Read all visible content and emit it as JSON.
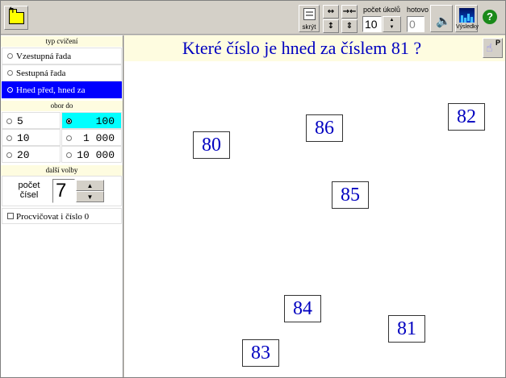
{
  "toolbar": {
    "hide_label": "skrýt",
    "count_label": "počet úkolů",
    "count_value": "10",
    "done_label": "hotovo",
    "done_value": "0",
    "results_label": "Výsledky",
    "help_symbol": "?",
    "hand_letter": "P"
  },
  "sidebar": {
    "exercise_type_header": "typ cvičení",
    "exercise_types": [
      {
        "label": "Vzestupná řada",
        "selected": false
      },
      {
        "label": "Sestupná řada",
        "selected": false
      },
      {
        "label": "Hned před, hned za",
        "selected": true
      }
    ],
    "range_header": "obor do",
    "ranges_left": [
      "5",
      "10",
      "20"
    ],
    "ranges_right": [
      "100",
      "1 000",
      "10 000"
    ],
    "range_selected": "100",
    "options_header": "další volby",
    "count_label_line1": "počet",
    "count_label_line2": "čísel",
    "count_value": "7",
    "zero_label": "Procvičovat i číslo 0"
  },
  "main": {
    "question": "Které číslo je hned za číslem 81 ?",
    "cards": [
      "80",
      "86",
      "82",
      "85",
      "84",
      "81",
      "83"
    ]
  },
  "colors": {
    "selection_blue": "#0000ff",
    "range_highlight": "#00ffff",
    "question_text": "#0000c0",
    "header_bg": "#fefce0"
  }
}
